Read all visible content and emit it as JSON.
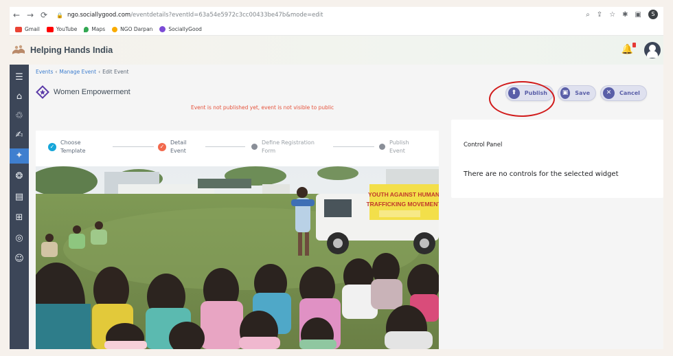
{
  "browser": {
    "url_domain": "ngo.sociallygood.com",
    "url_path": "/eventdetails?eventId=63a54e5972c3cc00433be47b&mode=edit",
    "profile_initial": "S",
    "bookmarks": [
      {
        "label": "Gmail",
        "color": "#ea4335"
      },
      {
        "label": "YouTube",
        "color": "#ff0000"
      },
      {
        "label": "Maps",
        "color": "#34a853"
      },
      {
        "label": "NGO Darpan",
        "color": "#f9ab00"
      },
      {
        "label": "SociallyGood",
        "color": "#7b4bd6"
      }
    ]
  },
  "header": {
    "brand": "Helping Hands India",
    "notification_count": "0"
  },
  "sidebar": {
    "icons": [
      "menu-icon",
      "home-icon",
      "donation-icon",
      "pledge-icon",
      "event-icon",
      "award-icon",
      "profile-card-icon",
      "ngo-icon",
      "csr-icon",
      "users-icon"
    ],
    "active": "event-icon"
  },
  "breadcrumb": {
    "items": [
      "Events",
      "Manage Event",
      "Edit Event"
    ]
  },
  "event": {
    "title": "Women Empowerment",
    "notice": "Event is not published yet, event is not visible to public"
  },
  "actions": {
    "publish": "Publish",
    "save": "Save",
    "cancel": "Cancel"
  },
  "stepper": {
    "steps": [
      {
        "line1": "Choose",
        "line2": "Template",
        "state": "done"
      },
      {
        "line1": "Detail",
        "line2": "Event",
        "state": "current"
      },
      {
        "line1": "Define Registration",
        "line2": "Form",
        "state": "todo"
      },
      {
        "line1": "Publish",
        "line2": "Event",
        "state": "todo"
      }
    ]
  },
  "photo": {
    "banner_line1": "YOUTH AGAINST HUMAN",
    "banner_line2": "TRAFFICKING MOVEMENT"
  },
  "control_panel": {
    "title": "Control Panel",
    "message": "There are no controls for the selected widget"
  },
  "colors": {
    "accent": "#3f7fcf",
    "sidebar": "#3c4658",
    "notice": "#e5533c",
    "button": "#5a5fa8",
    "highlight": "#d11b1b"
  }
}
